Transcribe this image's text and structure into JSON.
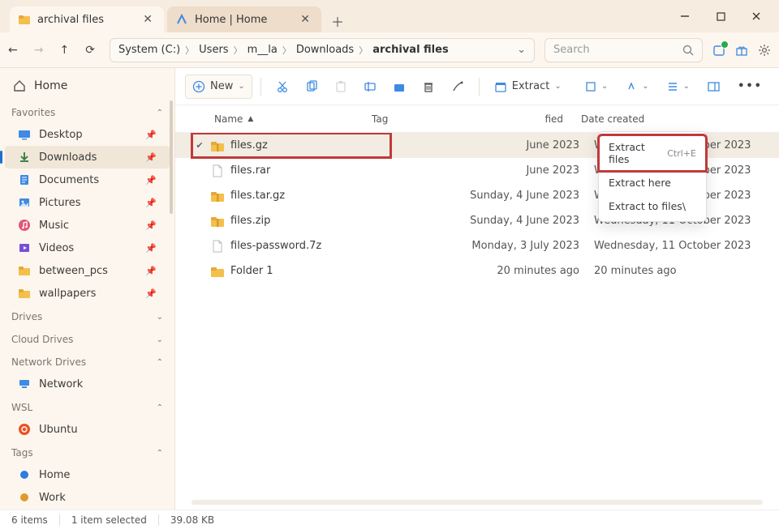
{
  "tabs": {
    "active": {
      "label": "archival files",
      "icon": "folder"
    },
    "inactive": {
      "label": "Home | Home",
      "icon": "home"
    }
  },
  "window": {
    "minimize": "—",
    "maximize": "▢",
    "close": "✕"
  },
  "breadcrumbs": [
    "System (C:)",
    "Users",
    "m__la",
    "Downloads",
    "archival files"
  ],
  "search": {
    "placeholder": "Search"
  },
  "sidebar": {
    "home": "Home",
    "sections": {
      "favorites": {
        "label": "Favorites",
        "items": [
          {
            "label": "Desktop",
            "icon": "desktop",
            "pinned": true
          },
          {
            "label": "Downloads",
            "icon": "download",
            "pinned": true,
            "active": true
          },
          {
            "label": "Documents",
            "icon": "document",
            "pinned": true
          },
          {
            "label": "Pictures",
            "icon": "pictures",
            "pinned": true
          },
          {
            "label": "Music",
            "icon": "music",
            "pinned": true
          },
          {
            "label": "Videos",
            "icon": "video",
            "pinned": true
          },
          {
            "label": "between_pcs",
            "icon": "folder",
            "pinned": true
          },
          {
            "label": "wallpapers",
            "icon": "folder",
            "pinned": true
          }
        ]
      },
      "drives": {
        "label": "Drives"
      },
      "cloud_drives": {
        "label": "Cloud Drives"
      },
      "network_drives": {
        "label": "Network Drives",
        "items": [
          {
            "label": "Network",
            "icon": "network"
          }
        ]
      },
      "wsl": {
        "label": "WSL",
        "items": [
          {
            "label": "Ubuntu",
            "icon": "ubuntu"
          }
        ]
      },
      "tags": {
        "label": "Tags",
        "items": [
          {
            "label": "Home",
            "icon": "dot-blue"
          },
          {
            "label": "Work",
            "icon": "dot-orange"
          }
        ]
      }
    }
  },
  "toolbar": {
    "new": "New",
    "extract": "Extract"
  },
  "extract_menu": [
    {
      "label": "Extract files",
      "shortcut": "Ctrl+E"
    },
    {
      "label": "Extract here"
    },
    {
      "label": "Extract to files\\"
    }
  ],
  "columns": {
    "name": "Name",
    "tag": "Tag",
    "modified": "fied",
    "created": "Date created"
  },
  "files": [
    {
      "name": "files.gz",
      "icon": "archive-folder",
      "modified_visible": "June 2023",
      "created": "Wednesday, 11 October 2023",
      "selected": true,
      "highlight": true
    },
    {
      "name": "files.rar",
      "icon": "file",
      "modified_visible": "June 2023",
      "created": "Wednesday, 11 October 2023"
    },
    {
      "name": "files.tar.gz",
      "icon": "archive-folder",
      "modified_visible": "Sunday, 4 June 2023",
      "created": "Wednesday, 11 October 2023"
    },
    {
      "name": "files.zip",
      "icon": "archive-folder",
      "modified_visible": "Sunday, 4 June 2023",
      "created": "Wednesday, 11 October 2023"
    },
    {
      "name": "files-password.7z",
      "icon": "file",
      "modified_visible": "Monday, 3 July 2023",
      "created": "Wednesday, 11 October 2023"
    },
    {
      "name": "Folder 1",
      "icon": "folder",
      "modified_visible": "20 minutes ago",
      "created": "20 minutes ago"
    }
  ],
  "status": {
    "count": "6 items",
    "selected": "1 item selected",
    "size": "39.08 KB"
  }
}
